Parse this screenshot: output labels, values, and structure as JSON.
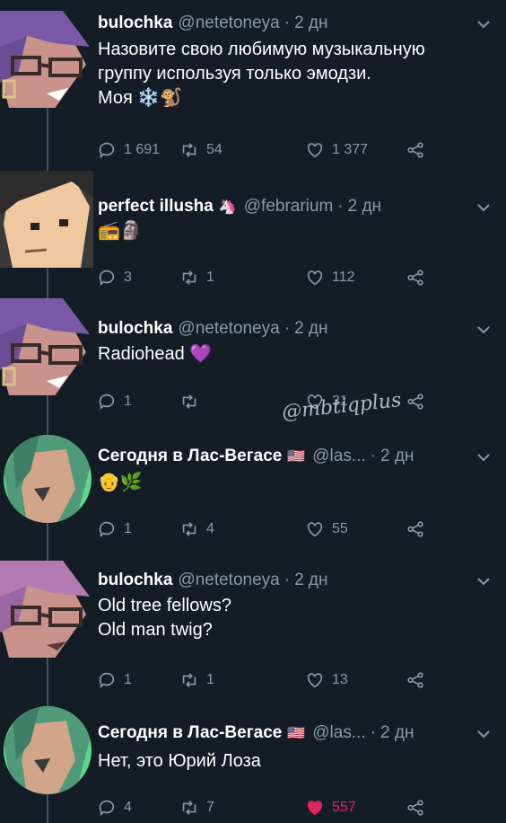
{
  "tweets": [
    {
      "name": "bulochka",
      "handle": "@netetoneya",
      "time": "2 дн",
      "text_lines": [
        "Назовите свою любимую музыкальную",
        "группу используя только эмодзи.",
        "Моя ❄️🐒"
      ],
      "replies": "1 691",
      "retweets": "54",
      "likes": "1 377"
    },
    {
      "name": "perfect illusha",
      "name_emoji": "🦄",
      "handle": "@febrarium",
      "time": "2 дн",
      "text_lines": [
        "📻🗿"
      ],
      "replies": "3",
      "retweets": "1",
      "likes": "112"
    },
    {
      "name": "bulochka",
      "handle": "@netetoneya",
      "time": "2 дн",
      "text_lines": [
        "Radiohead 💜"
      ],
      "replies": "1",
      "retweets": "",
      "likes": "31"
    },
    {
      "name": "Сегодня в Лас-Вегасе",
      "name_emoji": "🇺🇸",
      "handle": "@las...",
      "time": "2 дн",
      "text_lines": [
        "👴🌿"
      ],
      "replies": "1",
      "retweets": "4",
      "likes": "55"
    },
    {
      "name": "bulochka",
      "handle": "@netetoneya",
      "time": "2 дн",
      "text_lines": [
        "Old tree fellows?",
        "Old man twig?"
      ],
      "replies": "1",
      "retweets": "1",
      "likes": "13"
    },
    {
      "name": "Сегодня в Лас-Вегасе",
      "name_emoji": "🇺🇸",
      "handle": "@las...",
      "time": "2 дн",
      "text_lines": [
        "Нет, это Юрий Лоза"
      ],
      "replies": "4",
      "retweets": "7",
      "likes": "557",
      "liked": true
    }
  ],
  "separator": "·",
  "watermark": "@mbtiqplus",
  "colors": {
    "background": "#141d26",
    "muted": "#8899a6",
    "like_active": "#e0245e",
    "thread_line": "#3d5466"
  },
  "icons": [
    "reply-icon",
    "retweet-icon",
    "like-icon",
    "share-icon",
    "caret-down-icon"
  ]
}
